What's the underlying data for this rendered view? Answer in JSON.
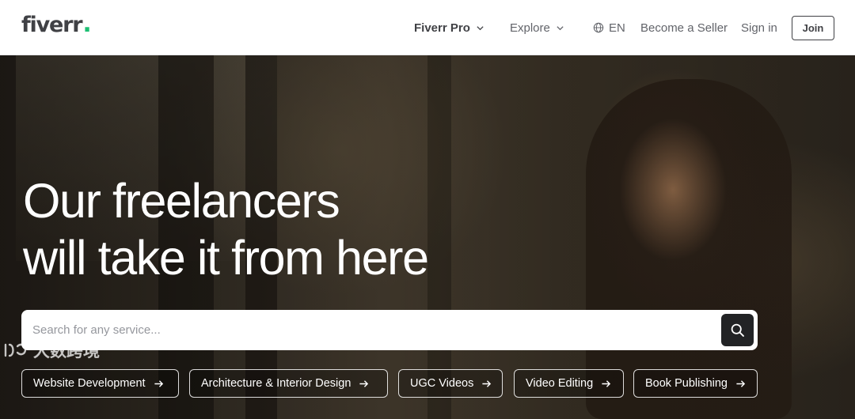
{
  "header": {
    "logo_text": "fiverr",
    "logo_dot": ".",
    "nav": {
      "pro": "Fiverr Pro",
      "explore": "Explore",
      "language": "EN",
      "become_seller": "Become a Seller",
      "sign_in": "Sign in",
      "join": "Join"
    }
  },
  "hero": {
    "headline_line1": "Our freelancers",
    "headline_line2": "will take it from here",
    "search": {
      "placeholder": "Search for any service...",
      "value": ""
    },
    "chips": [
      "Website Development",
      "Architecture & Interior Design",
      "UGC Videos",
      "Video Editing",
      "Book Publishing"
    ]
  },
  "watermark": "大数跨境",
  "colors": {
    "brand_green": "#1dbf73",
    "text_dark": "#404145",
    "text_muted": "#62646a",
    "search_button": "#222325"
  },
  "icons": {
    "language": "globe-icon",
    "dropdown": "chevron-down-icon",
    "search": "search-icon",
    "chip": "arrow-right-icon"
  }
}
